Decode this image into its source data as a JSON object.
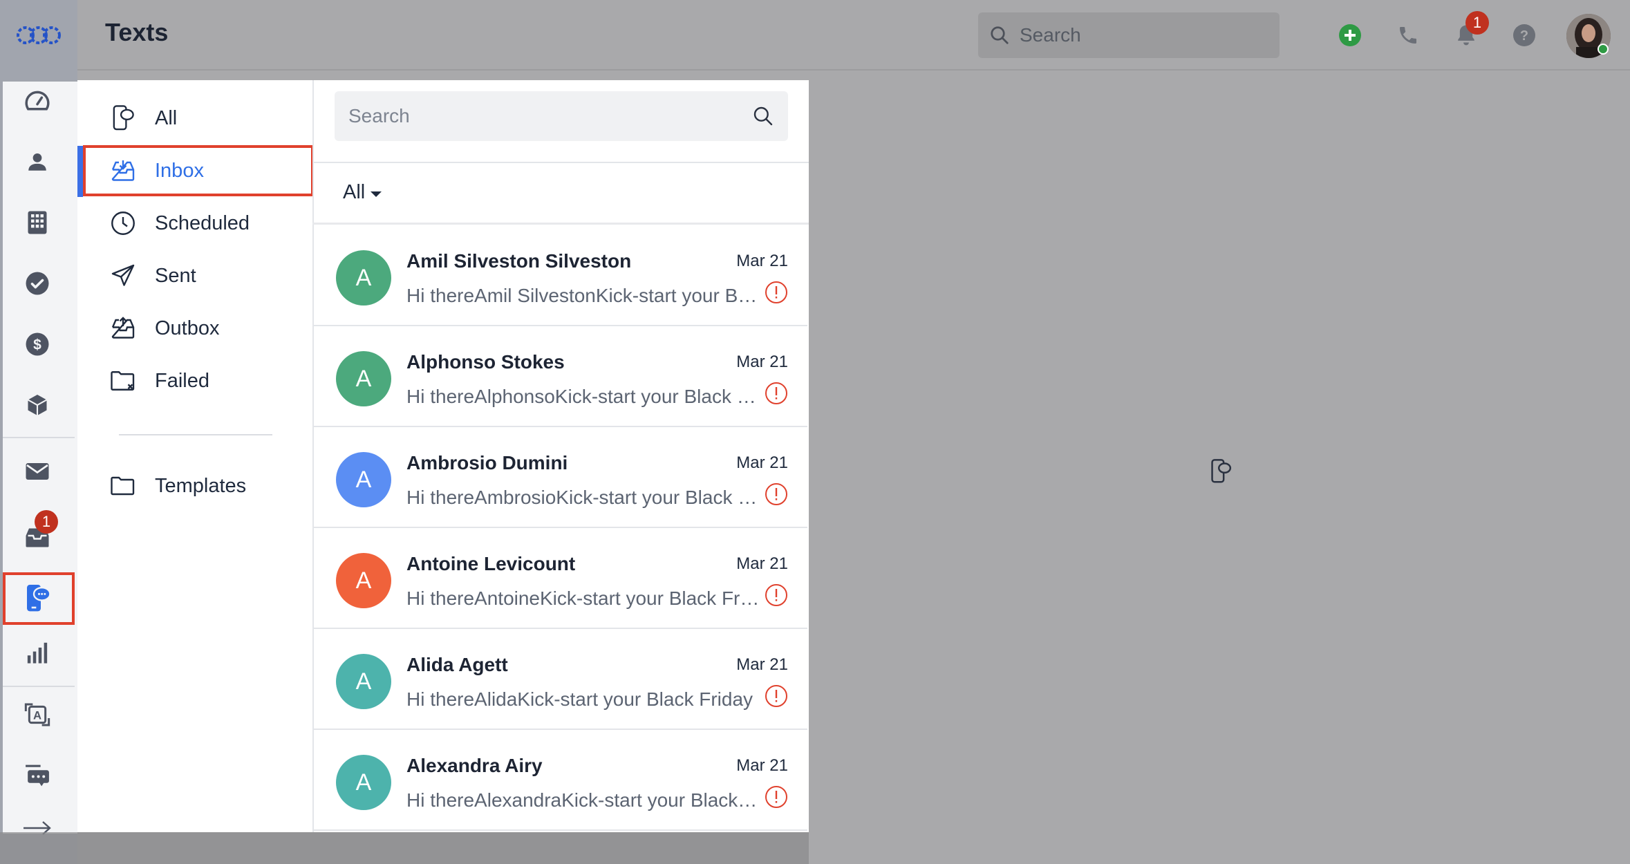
{
  "header": {
    "title": "Texts",
    "search_placeholder": "Search",
    "notifications_count": "1"
  },
  "rail": {
    "inbox_badge": "1",
    "items": [
      {
        "icon": "dashboard-icon"
      },
      {
        "icon": "contacts-icon"
      },
      {
        "icon": "companies-icon"
      },
      {
        "icon": "tasks-icon"
      },
      {
        "icon": "deals-icon"
      },
      {
        "icon": "products-icon"
      },
      {
        "icon": "email-icon"
      },
      {
        "icon": "inbox-icon"
      },
      {
        "icon": "texts-icon"
      },
      {
        "icon": "reports-icon"
      },
      {
        "icon": "automation-icon"
      },
      {
        "icon": "chat-icon"
      },
      {
        "icon": "expand-arrow-icon"
      }
    ]
  },
  "folders": {
    "all": "All",
    "inbox": "Inbox",
    "scheduled": "Scheduled",
    "sent": "Sent",
    "outbox": "Outbox",
    "failed": "Failed",
    "templates": "Templates"
  },
  "list": {
    "search_placeholder": "Search",
    "filter_label": "All",
    "messages": [
      {
        "initial": "A",
        "name": "Amil Silveston Silveston",
        "date": "Mar 21",
        "preview": "Hi thereAmil SilvestonKick-start your Black Friday",
        "color": "#4ca97d"
      },
      {
        "initial": "A",
        "name": "Alphonso Stokes",
        "date": "Mar 21",
        "preview": "Hi thereAlphonsoKick-start your Black Friday",
        "color": "#4ca97d"
      },
      {
        "initial": "A",
        "name": "Ambrosio Dumini",
        "date": "Mar 21",
        "preview": "Hi thereAmbrosioKick-start your Black Friday",
        "color": "#5b8ef3"
      },
      {
        "initial": "A",
        "name": "Antoine Levicount",
        "date": "Mar 21",
        "preview": "Hi thereAntoineKick-start your Black Friday",
        "color": "#f0623b"
      },
      {
        "initial": "A",
        "name": "Alida Agett",
        "date": "Mar 21",
        "preview": "Hi thereAlidaKick-start your Black Friday",
        "color": "#4db3ac"
      },
      {
        "initial": "A",
        "name": "Alexandra Airy",
        "date": "Mar 21",
        "preview": "Hi thereAlexandraKick-start your Black Friday",
        "color": "#4db3ac"
      }
    ]
  },
  "colors": {
    "accent": "#2f6fe6",
    "highlight": "#e0412d",
    "alert": "#e0412d",
    "add_button": "#2e9a44"
  }
}
